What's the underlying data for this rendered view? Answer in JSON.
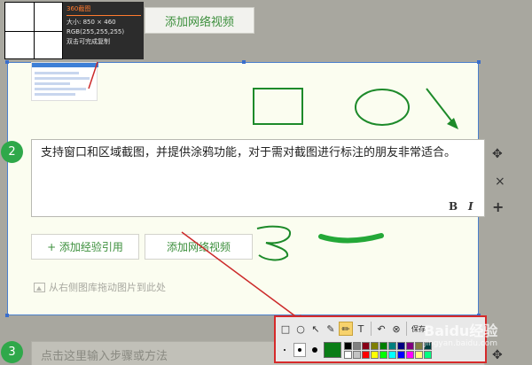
{
  "top_button": {
    "label": "添加网络视频"
  },
  "capture_info": {
    "title": "360截图",
    "size": "大小: 850 × 460",
    "rgb": "RGB(255,255,255)",
    "hint": "双击可完成复制"
  },
  "step2": {
    "number": "2",
    "text": "支持窗口和区域截图，并提供涂鸦功能，对于需对截图进行标注的朋友非常适合。",
    "bold_label": "B",
    "italic_label": "I"
  },
  "side_actions": {
    "move": "✥",
    "delete": "×",
    "add": "+"
  },
  "buttons": {
    "add_reference": "+ 添加经验引用",
    "add_video": "添加网络视频"
  },
  "drop_hint": "从右侧图库拖动图片到此处",
  "step3": {
    "number": "3",
    "placeholder": "点击这里输入步骤或方法"
  },
  "toolbar": {
    "tools": [
      {
        "name": "rectangle-tool-icon",
        "glyph": "□"
      },
      {
        "name": "ellipse-tool-icon",
        "glyph": "○"
      },
      {
        "name": "arrow-tool-icon",
        "glyph": "↖"
      },
      {
        "name": "brush-tool-icon",
        "glyph": "✎"
      },
      {
        "name": "pencil-tool-icon",
        "glyph": "✏"
      },
      {
        "name": "text-tool-icon",
        "glyph": "T"
      },
      {
        "name": "undo-icon",
        "glyph": "↶"
      },
      {
        "name": "cancel-icon",
        "glyph": "⊗"
      }
    ],
    "save_label": "保存",
    "current_color": "#0a7d16",
    "palette": [
      "#000000",
      "#7f7f7f",
      "#880015",
      "#7f7f00",
      "#008000",
      "#00807f",
      "#000080",
      "#800080",
      "#808040",
      "#004040",
      "#ffffff",
      "#c3c3c3",
      "#ff0000",
      "#ffff00",
      "#00ff00",
      "#00ffff",
      "#0000ff",
      "#ff00ff",
      "#ffff80",
      "#00ff80"
    ]
  },
  "watermark": {
    "main": "Baidu经验",
    "sub": "jingyan.baidu.com"
  },
  "colors": {
    "accent_green": "#3c8f3c",
    "annotation_red": "#cc2a2a",
    "annotation_green": "#1d8a2a",
    "selection_blue": "#4a7fcc"
  }
}
